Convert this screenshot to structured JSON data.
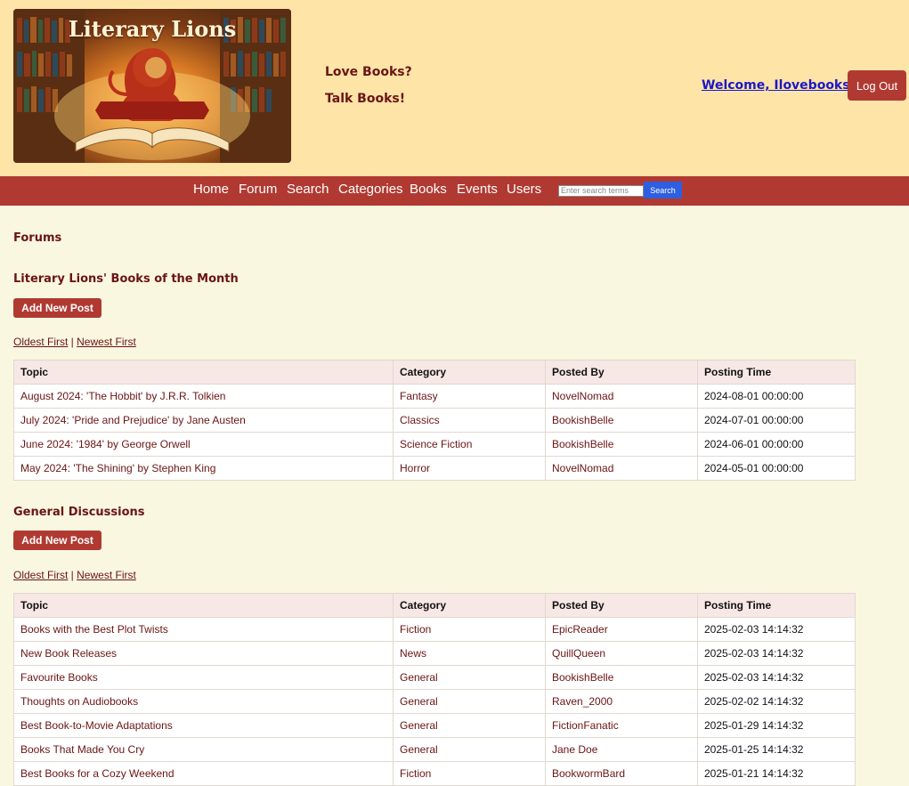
{
  "header": {
    "logo_text": "Literary Lions",
    "tagline_1": "Love Books?",
    "tagline_2": "Talk Books!",
    "welcome": "Welcome, Ilovebooks!",
    "logout": "Log Out"
  },
  "nav": {
    "items": [
      "Home",
      "Forum",
      "Search",
      "Categories",
      "Books",
      "Events",
      "Users"
    ],
    "search_placeholder": "Enter search terms",
    "search_button": "Search"
  },
  "page_title": "Forums",
  "sections": [
    {
      "title": "Literary Lions' Books of the Month",
      "add_button": "Add New Post",
      "sort_oldest": "Oldest First",
      "sort_sep": " | ",
      "sort_newest": "Newest First",
      "columns": [
        "Topic",
        "Category",
        "Posted By",
        "Posting Time"
      ],
      "rows": [
        [
          "August 2024: 'The Hobbit' by J.R.R. Tolkien",
          "Fantasy",
          "NovelNomad",
          "2024-08-01 00:00:00"
        ],
        [
          "July 2024: 'Pride and Prejudice' by Jane Austen",
          "Classics",
          "BookishBelle",
          "2024-07-01 00:00:00"
        ],
        [
          "June 2024: '1984' by George Orwell",
          "Science Fiction",
          "BookishBelle",
          "2024-06-01 00:00:00"
        ],
        [
          "May 2024: 'The Shining' by Stephen King",
          "Horror",
          "NovelNomad",
          "2024-05-01 00:00:00"
        ]
      ]
    },
    {
      "title": "General Discussions",
      "add_button": "Add New Post",
      "sort_oldest": "Oldest First",
      "sort_sep": " | ",
      "sort_newest": "Newest First",
      "columns": [
        "Topic",
        "Category",
        "Posted By",
        "Posting Time"
      ],
      "rows": [
        [
          "Books with the Best Plot Twists",
          "Fiction",
          "EpicReader",
          "2025-02-03 14:14:32"
        ],
        [
          "New Book Releases",
          "News",
          "QuillQueen",
          "2025-02-03 14:14:32"
        ],
        [
          "Favourite Books",
          "General",
          "BookishBelle",
          "2025-02-03 14:14:32"
        ],
        [
          "Thoughts on Audiobooks",
          "General",
          "Raven_2000",
          "2025-02-02 14:14:32"
        ],
        [
          "Best Book-to-Movie Adaptations",
          "General",
          "FictionFanatic",
          "2025-01-29 14:14:32"
        ],
        [
          "Books That Made You Cry",
          "General",
          "Jane Doe",
          "2025-01-25 14:14:32"
        ],
        [
          "Best Books for a Cozy Weekend",
          "Fiction",
          "BookwormBard",
          "2025-01-21 14:14:32"
        ]
      ]
    }
  ],
  "colors": {
    "header_bg": "#ffe4a8",
    "nav_bg": "#b03a32",
    "page_bg": "#faf7e0",
    "text": "#6a1414",
    "search_button": "#2d5fe0"
  }
}
